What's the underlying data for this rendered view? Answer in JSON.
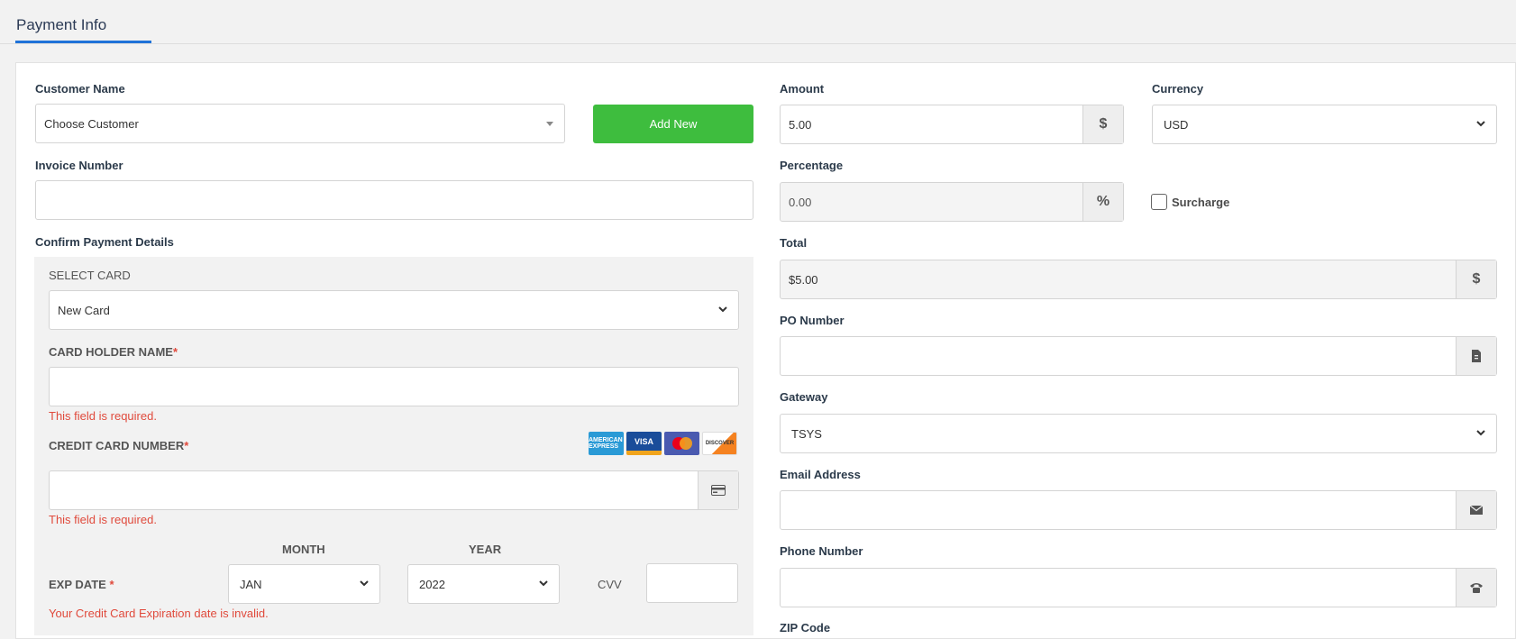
{
  "tab": {
    "title": "Payment Info"
  },
  "customer": {
    "label": "Customer Name",
    "value": "Choose Customer",
    "add_new": "Add New"
  },
  "invoice": {
    "label": "Invoice Number",
    "value": ""
  },
  "confirm": {
    "label": "Confirm Payment Details"
  },
  "select_card": {
    "label": "SELECT CARD",
    "value": "New Card"
  },
  "holder": {
    "label": "CARD HOLDER NAME",
    "required_mark": "*",
    "error": "This field is required."
  },
  "ccnum": {
    "label": "CREDIT CARD NUMBER",
    "required_mark": "*",
    "error": "This field is required."
  },
  "card_logos": [
    "AMERICAN EXPRESS",
    "VISA",
    "mastercard",
    "DISCOVER"
  ],
  "exp": {
    "label": "EXP DATE",
    "required_mark": "*",
    "month_label": "MONTH",
    "year_label": "YEAR",
    "month": "JAN",
    "year": "2022",
    "cvv_label": "CVV",
    "error": "Your Credit Card Expiration date is invalid."
  },
  "amount": {
    "label": "Amount",
    "value": "5.00",
    "addon": "$"
  },
  "currency": {
    "label": "Currency",
    "value": "USD"
  },
  "percentage": {
    "label": "Percentage",
    "value": "0.00",
    "addon": "%"
  },
  "surcharge": {
    "label": "Surcharge",
    "checked": false
  },
  "total": {
    "label": "Total",
    "value": "$5.00",
    "addon": "$"
  },
  "po": {
    "label": "PO Number",
    "icon": "document-icon"
  },
  "gateway": {
    "label": "Gateway",
    "value": "TSYS"
  },
  "email": {
    "label": "Email Address",
    "icon": "envelope-icon"
  },
  "phone": {
    "label": "Phone Number",
    "icon": "phone-icon"
  },
  "zip": {
    "label": "ZIP Code"
  },
  "colors": {
    "accent": "#1f72d8",
    "green": "#3ebd3e",
    "error": "#e04a3c"
  }
}
